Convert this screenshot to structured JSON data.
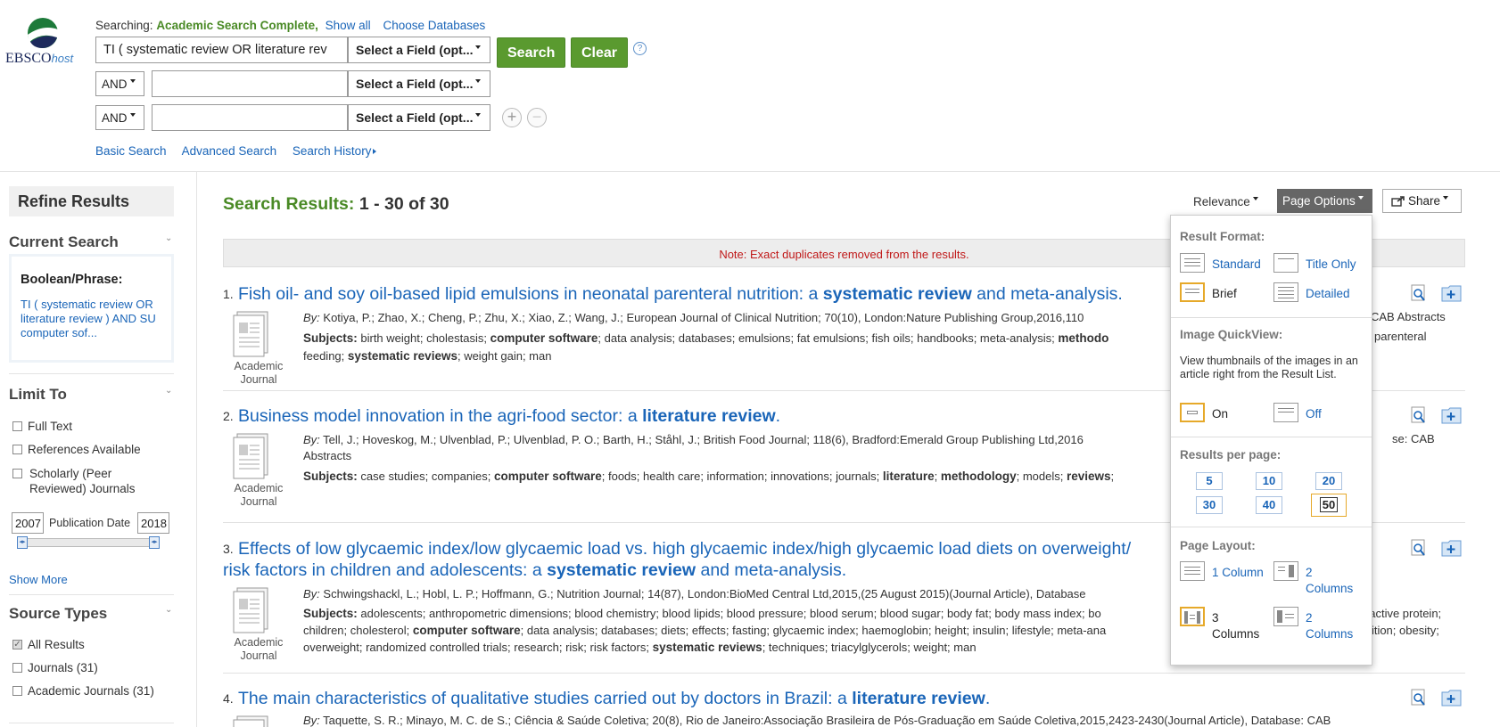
{
  "logo": {
    "text": "EBSCO",
    "suffix": "host"
  },
  "search": {
    "searching_label": "Searching:",
    "database": "Academic Search Complete,",
    "show_all": "Show all",
    "choose_databases": "Choose Databases",
    "query1": "TI ( systematic review OR literature rev",
    "field_placeholder": "Select a Field (opt...",
    "bool1": "AND",
    "bool2": "AND",
    "search_btn": "Search",
    "clear_btn": "Clear",
    "help": "?"
  },
  "nav": {
    "basic": "Basic Search",
    "advanced": "Advanced Search",
    "history": "Search History"
  },
  "sidebar": {
    "refine_title": "Refine Results",
    "current_search": "Current Search",
    "boolean_phrase": "Boolean/Phrase:",
    "query_text": "TI ( systematic review OR literature review ) AND SU computer sof...",
    "limit_to": "Limit To",
    "full_text": "Full Text",
    "references": "References Available",
    "scholarly": "Scholarly (Peer Reviewed) Journals",
    "date_from": "2007",
    "date_to": "2018",
    "pub_date": "Publication Date",
    "show_more": "Show More",
    "source_types": "Source Types",
    "all_results": "All Results",
    "journals": "Journals (31)",
    "academic_journals": "Academic Journals (31)"
  },
  "results": {
    "label": "Search Results:",
    "range": "1 - 30 of 30",
    "relevance": "Relevance",
    "page_options": "Page Options",
    "share": "Share",
    "note": "Note: Exact duplicates removed from the results."
  },
  "items": [
    {
      "num": "1.",
      "t1": "Fish oil- and soy oil-based lipid emulsions in neonatal parenteral nutrition: a ",
      "t2": "systematic review",
      "t3": " and meta-analysis.",
      "by": "By:",
      "byline": " Kotiya, P.; Zhao, X.; Cheng, P.; Zhu, X.; Xiao, Z.; Wang, J.;  European Journal of Clinical Nutrition;  70(10),  London:Nature Publishing Group,2016,110",
      "byline_tail": "CAB Abstracts",
      "subjects_label": "Subjects:",
      "s1": " birth weight; cholestasis; ",
      "s2": "computer software",
      "s3": "; data analysis; databases; emulsions; fat emulsions; fish oils; handbooks; meta-analysis; ",
      "s4": "methodo",
      "s5": "parenteral",
      "s6": "feeding; ",
      "s7": "systematic reviews",
      "s8": "; weight gain; man",
      "type_line1": "Academic",
      "type_line2": "Journal"
    },
    {
      "num": "2.",
      "t1": "Business model innovation in the agri-food sector: a ",
      "t2": "literature review",
      "t3": ".",
      "by": "By:",
      "byline": " Tell, J.; Hoveskog, M.; Ulvenblad, P.; Ulvenblad, P. O.; Barth, H.; Ståhl, J.;  British Food Journal;  118(6),  Bradford:Emerald Group Publishing Ltd,2016",
      "byline_tail": "se: CAB",
      "byline2": "Abstracts",
      "subjects_label": "Subjects:",
      "s1": " case studies; companies; ",
      "s2": "computer software",
      "s3": "; foods; health care; information; innovations; journals; ",
      "s4": "literature",
      "s5": "; ",
      "s6": "methodology",
      "s7": "; models; ",
      "s8": "reviews",
      "s9": ";",
      "type_line1": "Academic",
      "type_line2": "Journal"
    },
    {
      "num": "3.",
      "t1": "Effects of low glycaemic index/low glycaemic load vs. high glycaemic index/high glycaemic load diets on overweight/",
      "t1b": "risk factors in children and adolescents: a ",
      "t2": "systematic review",
      "t3": " and meta-analysis.",
      "by": "By:",
      "byline": " Schwingshackl, L.; Hobl, L. P.; Hoffmann, G.;  Nutrition Journal;  14(87),  London:BioMed Central Ltd,2015,(25 August 2015)(Journal Article), Database",
      "subjects_label": "Subjects:",
      "s1": " adolescents; anthropometric dimensions; blood chemistry; blood lipids; blood pressure; blood serum; blood sugar; body fat; body mass index; bo",
      "s1_tail": "eactive protein;",
      "s2a": "children; cholesterol; ",
      "s2": "computer software",
      "s3": "; data analysis; databases; diets; effects; fasting; glycaemic index; haemoglobin; height; insulin; lifestyle; meta-ana",
      "s3_tail": "trition; obesity;",
      "s4a": "overweight; randomized controlled trials; research; risk; risk factors; ",
      "s4": "systematic reviews",
      "s5": "; techniques; triacylglycerols; weight; man",
      "type_line1": "Academic",
      "type_line2": "Journal"
    },
    {
      "num": "4.",
      "t1": "The main characteristics of qualitative studies carried out by doctors in Brazil: a ",
      "t2": "literature review",
      "t3": ".",
      "by": "By:",
      "byline": " Taquette, S. R.; Minayo, M. C. de S.;  Ciência & Saúde Coletiva;  20(8),  Rio de Janeiro:Associação Brasileira de Pós-Graduação em Saúde Coletiva,2015,2423-2430(Journal Article), Database: CAB"
    }
  ],
  "page_options": {
    "result_format": "Result Format:",
    "standard": "Standard",
    "title_only": "Title Only",
    "brief": "Brief",
    "detailed": "Detailed",
    "image_quickview": "Image QuickView:",
    "iqv_text": "View thumbnails of the images in an article right from the Result List.",
    "on": "On",
    "off": "Off",
    "results_per_page": "Results per page:",
    "rpp": [
      "5",
      "10",
      "20",
      "30",
      "40",
      "50"
    ],
    "page_layout": "Page Layout:",
    "one_column": "1 Column",
    "two_columns": "2 Columns",
    "three_columns": "3 Columns",
    "two_columns_b": "2 Columns"
  }
}
